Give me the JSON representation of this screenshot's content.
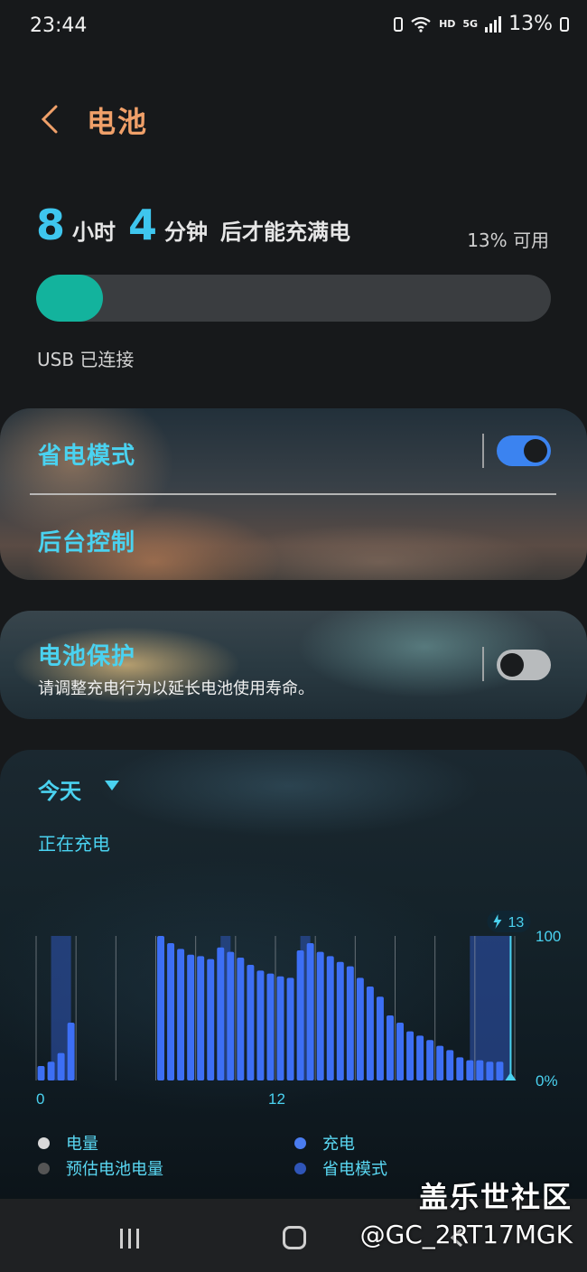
{
  "status_bar": {
    "time": "23:44",
    "network": "HD",
    "network_type": "5G",
    "battery_percent": "13%"
  },
  "header": {
    "title": "电池"
  },
  "charge": {
    "hours": "8",
    "hours_unit": "小时",
    "minutes": "4",
    "minutes_unit": "分钟",
    "suffix": "后才能充满电",
    "available": "13% 可用",
    "level": 0.13,
    "usb_status": "USB 已连接",
    "fill_color": "#13b39d"
  },
  "settings": {
    "power_saving": {
      "label": "省电模式",
      "enabled": true
    },
    "background_control": {
      "label": "后台控制"
    },
    "battery_protection": {
      "label": "电池保护",
      "description": "请调整充电行为以延长电池使用寿命。",
      "enabled": false
    }
  },
  "usage": {
    "period": "今天",
    "status": "正在充电",
    "current_badge": "13",
    "y_max_label": "100",
    "y_min_label": "0%",
    "x_labels": [
      "0",
      "12"
    ],
    "legend": [
      {
        "label": "电量",
        "color": "#d9d9d9"
      },
      {
        "label": "充电",
        "color": "#4a7cf0"
      },
      {
        "label": "预估电池电量",
        "color": "#555555"
      },
      {
        "label": "省电模式",
        "color": "#2f55b8"
      }
    ]
  },
  "chart_data": {
    "type": "bar",
    "x_unit": "hour",
    "xlim": [
      0,
      24
    ],
    "ylim": [
      0,
      100
    ],
    "x_tick_labels": [
      "0",
      "12"
    ],
    "y_tick_labels": [
      "0%",
      "100"
    ],
    "bar_color": "#3d6ff5",
    "shaded_color": "#2f55b8",
    "bars": [
      {
        "x": 0.25,
        "y": 10
      },
      {
        "x": 0.75,
        "y": 13
      },
      {
        "x": 1.25,
        "y": 19
      },
      {
        "x": 1.75,
        "y": 40
      },
      {
        "x": 6.25,
        "y": 100
      },
      {
        "x": 6.75,
        "y": 95
      },
      {
        "x": 7.25,
        "y": 91
      },
      {
        "x": 7.75,
        "y": 87
      },
      {
        "x": 8.25,
        "y": 86
      },
      {
        "x": 8.75,
        "y": 84
      },
      {
        "x": 9.25,
        "y": 92
      },
      {
        "x": 9.75,
        "y": 89
      },
      {
        "x": 10.25,
        "y": 85
      },
      {
        "x": 10.75,
        "y": 80
      },
      {
        "x": 11.25,
        "y": 76
      },
      {
        "x": 11.75,
        "y": 74
      },
      {
        "x": 12.25,
        "y": 72
      },
      {
        "x": 12.75,
        "y": 71
      },
      {
        "x": 13.25,
        "y": 90
      },
      {
        "x": 13.75,
        "y": 95
      },
      {
        "x": 14.25,
        "y": 89
      },
      {
        "x": 14.75,
        "y": 86
      },
      {
        "x": 15.25,
        "y": 82
      },
      {
        "x": 15.75,
        "y": 79
      },
      {
        "x": 16.25,
        "y": 71
      },
      {
        "x": 16.75,
        "y": 65
      },
      {
        "x": 17.25,
        "y": 58
      },
      {
        "x": 17.75,
        "y": 45
      },
      {
        "x": 18.25,
        "y": 40
      },
      {
        "x": 18.75,
        "y": 34
      },
      {
        "x": 19.25,
        "y": 31
      },
      {
        "x": 19.75,
        "y": 28
      },
      {
        "x": 20.25,
        "y": 24
      },
      {
        "x": 20.75,
        "y": 21
      },
      {
        "x": 21.25,
        "y": 16
      },
      {
        "x": 21.75,
        "y": 14
      },
      {
        "x": 22.25,
        "y": 14
      },
      {
        "x": 22.75,
        "y": 13
      },
      {
        "x": 23.25,
        "y": 13
      }
    ],
    "shaded_ranges": [
      [
        0.75,
        1.75
      ],
      [
        9.25,
        9.75
      ],
      [
        13.25,
        13.75
      ],
      [
        21.75,
        23.75
      ]
    ]
  },
  "watermark": {
    "site": "盖乐世社区",
    "user": "@GC_2RT17MGK"
  }
}
